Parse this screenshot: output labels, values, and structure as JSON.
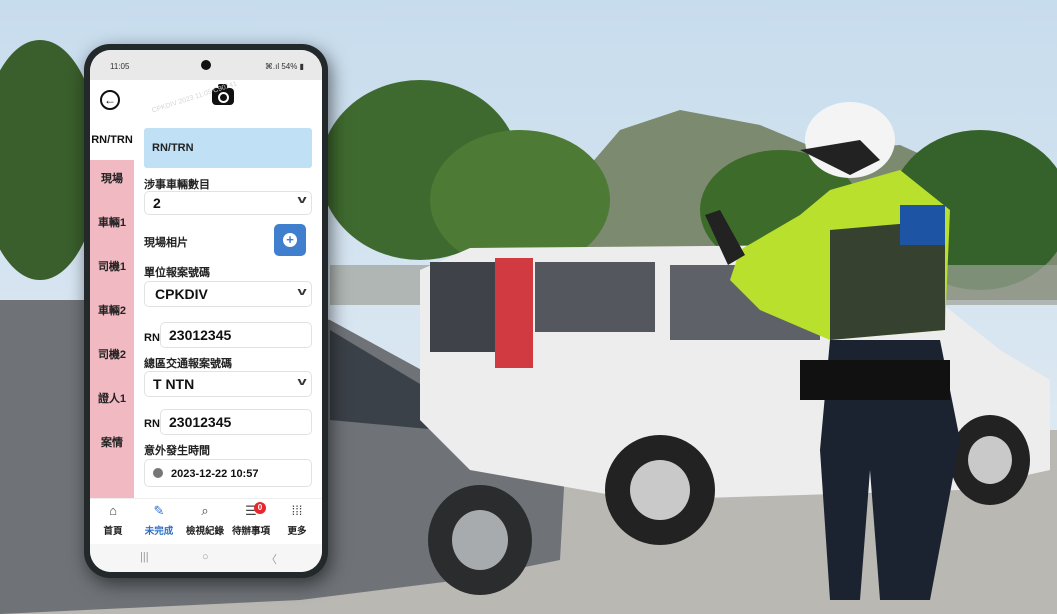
{
  "status_bar": {
    "time": "11:05",
    "system": "⌘.ıl 54% ▮"
  },
  "watermark": "CPKDIV 2023 11:05 C90141",
  "nav": {
    "active": "RN/TRN",
    "items": [
      "現場",
      "車輛1",
      "司機1",
      "車輛2",
      "司機2",
      "證人1",
      "案情"
    ]
  },
  "form": {
    "section_title": "RN/TRN",
    "vehicles_label": "涉事車輛數目",
    "vehicles_value": "2",
    "photos_label": "現場相片",
    "unit_label": "單位報案號碼",
    "unit_value": "CPKDIV",
    "rn_prefix": "RN",
    "rn_value": "23012345",
    "district_label": "總區交通報案號碼",
    "district_value": "T NTN",
    "rn2_prefix": "RN",
    "rn2_value": "23012345",
    "time_label": "意外發生時間",
    "time_value": "2023-12-22 10:57"
  },
  "bottom_nav": {
    "items": [
      {
        "label": "首頁",
        "icon": "home-icon"
      },
      {
        "label": "未完成",
        "icon": "edit-icon"
      },
      {
        "label": "檢視紀錄",
        "icon": "search-record-icon"
      },
      {
        "label": "待辦事項",
        "icon": "todo-icon",
        "badge": "0"
      },
      {
        "label": "更多",
        "icon": "grid-icon"
      }
    ]
  },
  "system_nav": {
    "recent": "|||",
    "home": "○",
    "back": "〈"
  },
  "colors": {
    "nav_pink": "#f1b9c2",
    "header_blue": "#bfe0f5",
    "accent": "#3f7fce",
    "badge_red": "#e8262b"
  }
}
